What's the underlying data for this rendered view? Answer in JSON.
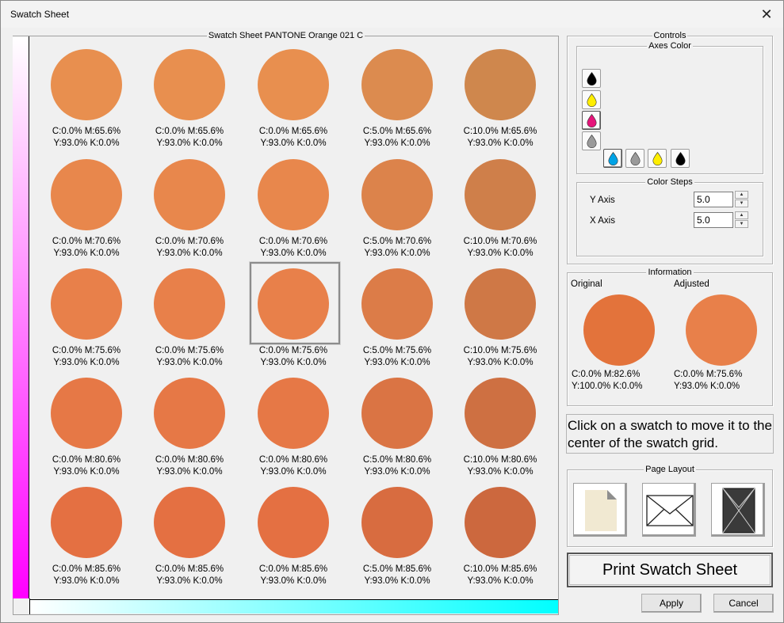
{
  "window": {
    "title": "Swatch Sheet",
    "close_glyph": "✕"
  },
  "sheet": {
    "legend": "Swatch Sheet PANTONE Orange 021 C",
    "selected_index": 12,
    "swatches": [
      {
        "color": "#e88f4f",
        "line1": "C:0.0% M:65.6%",
        "line2": "Y:93.0% K:0.0%"
      },
      {
        "color": "#e88f4f",
        "line1": "C:0.0% M:65.6%",
        "line2": "Y:93.0% K:0.0%"
      },
      {
        "color": "#e88f4f",
        "line1": "C:0.0% M:65.6%",
        "line2": "Y:93.0% K:0.0%"
      },
      {
        "color": "#dc8b4f",
        "line1": "C:5.0% M:65.6%",
        "line2": "Y:93.0% K:0.0%"
      },
      {
        "color": "#cf874d",
        "line1": "C:10.0% M:65.6%",
        "line2": "Y:93.0% K:0.0%"
      },
      {
        "color": "#e8874c",
        "line1": "C:0.0% M:70.6%",
        "line2": "Y:93.0% K:0.0%"
      },
      {
        "color": "#e8874c",
        "line1": "C:0.0% M:70.6%",
        "line2": "Y:93.0% K:0.0%"
      },
      {
        "color": "#e8874c",
        "line1": "C:0.0% M:70.6%",
        "line2": "Y:93.0% K:0.0%"
      },
      {
        "color": "#dc834b",
        "line1": "C:5.0% M:70.6%",
        "line2": "Y:93.0% K:0.0%"
      },
      {
        "color": "#cf7f4a",
        "line1": "C:10.0% M:70.6%",
        "line2": "Y:93.0% K:0.0%"
      },
      {
        "color": "#e8804a",
        "line1": "C:0.0% M:75.6%",
        "line2": "Y:93.0% K:0.0%"
      },
      {
        "color": "#e8804a",
        "line1": "C:0.0% M:75.6%",
        "line2": "Y:93.0% K:0.0%"
      },
      {
        "color": "#e8804a",
        "line1": "C:0.0% M:75.6%",
        "line2": "Y:93.0% K:0.0%"
      },
      {
        "color": "#dc7c48",
        "line1": "C:5.0% M:75.6%",
        "line2": "Y:93.0% K:0.0%"
      },
      {
        "color": "#cf7846",
        "line1": "C:10.0% M:75.6%",
        "line2": "Y:93.0% K:0.0%"
      },
      {
        "color": "#e67846",
        "line1": "C:0.0% M:80.6%",
        "line2": "Y:93.0% K:0.0%"
      },
      {
        "color": "#e67846",
        "line1": "C:0.0% M:80.6%",
        "line2": "Y:93.0% K:0.0%"
      },
      {
        "color": "#e67846",
        "line1": "C:0.0% M:80.6%",
        "line2": "Y:93.0% K:0.0%"
      },
      {
        "color": "#da7444",
        "line1": "C:5.0% M:80.6%",
        "line2": "Y:93.0% K:0.0%"
      },
      {
        "color": "#ce7042",
        "line1": "C:10.0% M:80.6%",
        "line2": "Y:93.0% K:0.0%"
      },
      {
        "color": "#e47042",
        "line1": "C:0.0% M:85.6%",
        "line2": "Y:93.0% K:0.0%"
      },
      {
        "color": "#e47042",
        "line1": "C:0.0% M:85.6%",
        "line2": "Y:93.0% K:0.0%"
      },
      {
        "color": "#e47042",
        "line1": "C:0.0% M:85.6%",
        "line2": "Y:93.0% K:0.0%"
      },
      {
        "color": "#d86c40",
        "line1": "C:5.0% M:85.6%",
        "line2": "Y:93.0% K:0.0%"
      },
      {
        "color": "#cc683e",
        "line1": "C:10.0% M:85.6%",
        "line2": "Y:93.0% K:0.0%"
      }
    ],
    "y_axis_gradient": [
      "#ffffff",
      "#ff00ff"
    ],
    "x_axis_gradient": [
      "#ffffff",
      "#00ffff"
    ]
  },
  "controls": {
    "legend": "Controls",
    "axes_color": {
      "legend": "Axes Color",
      "vertical_drops": [
        "black-drop-icon",
        "yellow-drop-icon",
        "magenta-drop-icon",
        "gray-drop-icon"
      ],
      "horizontal_drops": [
        "cyan-drop-icon",
        "gray-drop-icon",
        "yellow-drop-icon",
        "black-drop-icon"
      ],
      "drop_colors": {
        "black": "#000000",
        "yellow": "#ffee00",
        "magenta": "#e5157a",
        "gray": "#9a9a9a",
        "cyan": "#00a3e6"
      }
    },
    "color_steps": {
      "legend": "Color Steps",
      "y_label": "Y Axis",
      "y_value": "5.0",
      "x_label": "X Axis",
      "x_value": "5.0"
    }
  },
  "information": {
    "legend": "Information",
    "original_label": "Original",
    "original_color": "#e3733b",
    "original_line1": "C:0.0% M:82.6%",
    "original_line2": "Y:100.0% K:0.0%",
    "adjusted_label": "Adjusted",
    "adjusted_color": "#e8804a",
    "adjusted_line1": "C:0.0% M:75.6%",
    "adjusted_line2": "Y:93.0% K:0.0%"
  },
  "hint": "Click on a swatch to move it to the center of the swatch grid.",
  "page_layout": {
    "legend": "Page Layout",
    "options": [
      "document-page-icon",
      "envelope-icon",
      "dark-envelope-icon"
    ]
  },
  "buttons": {
    "print": "Print Swatch Sheet",
    "apply": "Apply",
    "cancel": "Cancel"
  }
}
